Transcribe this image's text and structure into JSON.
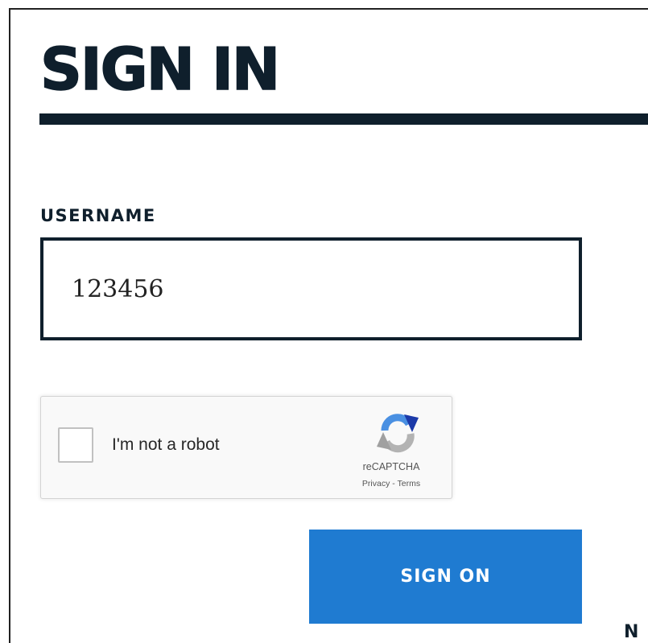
{
  "page": {
    "title": "SIGN IN"
  },
  "username": {
    "label": "USERNAME",
    "value": "123456"
  },
  "recaptcha": {
    "checkbox_label": "I'm not a robot",
    "checked": false,
    "brand": "reCAPTCHA",
    "privacy_label": "Privacy",
    "separator": "-",
    "terms_label": "Terms",
    "icon": "recaptcha-logo-icon"
  },
  "actions": {
    "sign_on_label": "SIGN ON"
  },
  "partial": {
    "cut_off_text": "N"
  },
  "colors": {
    "heading": "#0f1f2c",
    "button": "#1f7bd1",
    "recaptcha_bg": "#f9f9f9"
  }
}
